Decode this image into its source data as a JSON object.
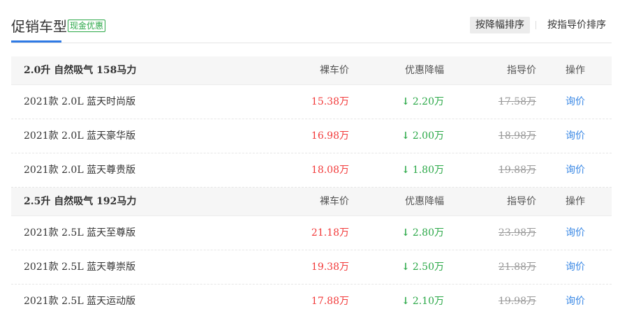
{
  "header": {
    "title": "促销车型",
    "badge": "现金优惠",
    "sort_options": [
      {
        "label": "按降幅排序",
        "active": true
      },
      {
        "label": "按指导价排序",
        "active": false
      }
    ]
  },
  "columns": {
    "price": "裸车价",
    "discount": "优惠降幅",
    "guide": "指导价",
    "op": "操作"
  },
  "groups": [
    {
      "name": "2.0升 自然吸气 158马力",
      "rows": [
        {
          "model": "2021款 2.0L 蓝天时尚版",
          "price": "15.38万",
          "discount": "2.20万",
          "guide": "17.58万",
          "action": "询价"
        },
        {
          "model": "2021款 2.0L 蓝天豪华版",
          "price": "16.98万",
          "discount": "2.00万",
          "guide": "18.98万",
          "action": "询价"
        },
        {
          "model": "2021款 2.0L 蓝天尊贵版",
          "price": "18.08万",
          "discount": "1.80万",
          "guide": "19.88万",
          "action": "询价"
        }
      ]
    },
    {
      "name": "2.5升 自然吸气 192马力",
      "rows": [
        {
          "model": "2021款 2.5L 蓝天至尊版",
          "price": "21.18万",
          "discount": "2.80万",
          "guide": "23.98万",
          "action": "询价"
        },
        {
          "model": "2021款 2.5L 蓝天尊崇版",
          "price": "19.38万",
          "discount": "2.50万",
          "guide": "21.88万",
          "action": "询价"
        },
        {
          "model": "2021款 2.5L 蓝天运动版",
          "price": "17.88万",
          "discount": "2.10万",
          "guide": "19.98万",
          "action": "询价"
        }
      ]
    }
  ],
  "icons": {
    "discount_arrow": "arrow-down-icon"
  },
  "colors": {
    "accent": "#2f7ae5",
    "price": "#f23a3a",
    "discount": "#2aa847",
    "link": "#3a88e5"
  }
}
